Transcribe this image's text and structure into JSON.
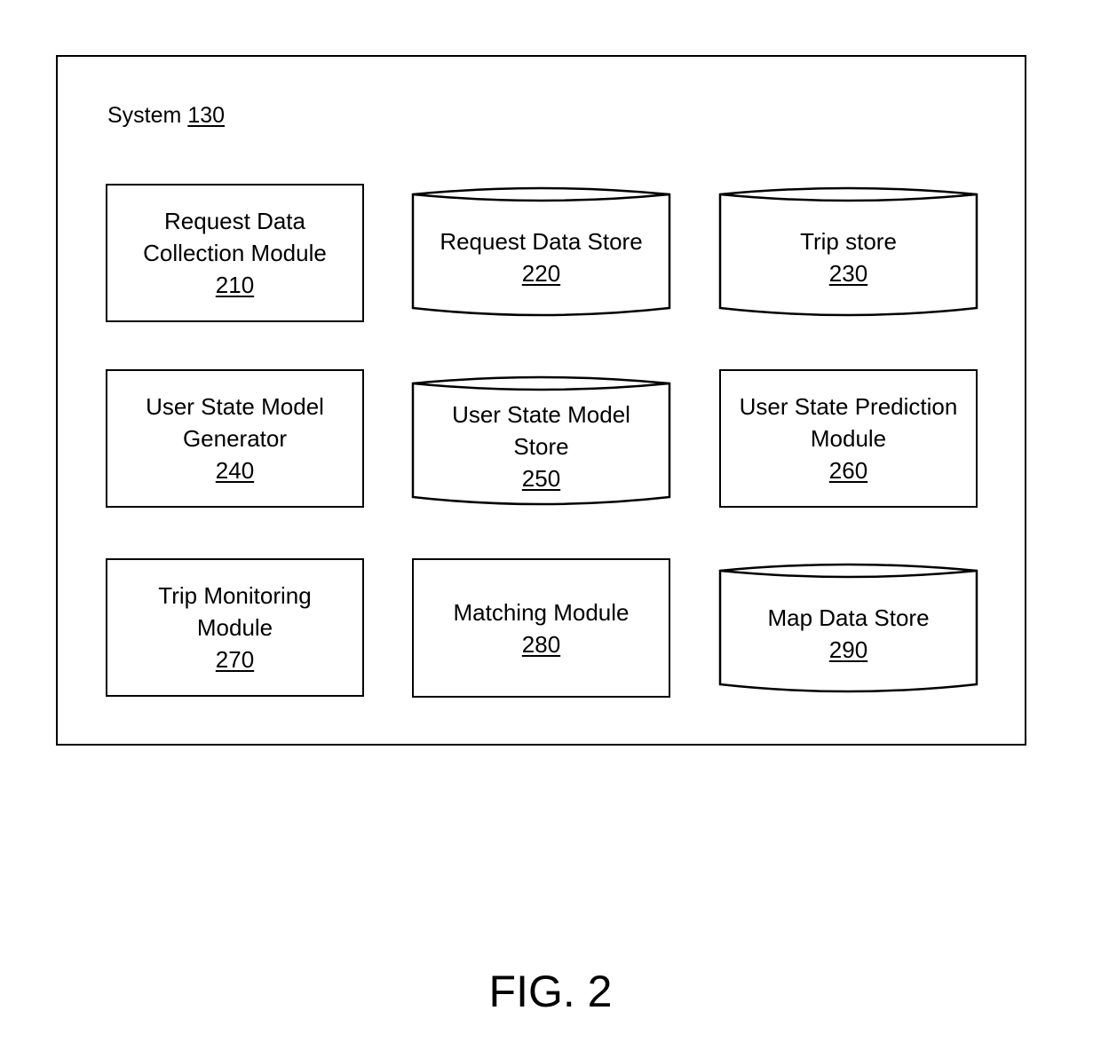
{
  "system": {
    "label": "System",
    "ref": "130"
  },
  "nodes": [
    {
      "id": "210",
      "shape": "rect",
      "lines": [
        "Request Data",
        "Collection Module"
      ],
      "ref": "210"
    },
    {
      "id": "220",
      "shape": "cylinder",
      "lines": [
        "Request Data Store"
      ],
      "ref": "220"
    },
    {
      "id": "230",
      "shape": "cylinder",
      "lines": [
        "Trip store"
      ],
      "ref": "230"
    },
    {
      "id": "240",
      "shape": "rect",
      "lines": [
        "User State Model",
        "Generator"
      ],
      "ref": "240"
    },
    {
      "id": "250",
      "shape": "cylinder",
      "lines": [
        "User State Model",
        "Store"
      ],
      "ref": "250"
    },
    {
      "id": "260",
      "shape": "rect",
      "lines": [
        "User State Prediction",
        "Module"
      ],
      "ref": "260"
    },
    {
      "id": "270",
      "shape": "rect",
      "lines": [
        "Trip Monitoring",
        "Module"
      ],
      "ref": "270"
    },
    {
      "id": "280",
      "shape": "rect",
      "lines": [
        "Matching Module"
      ],
      "ref": "280"
    },
    {
      "id": "290",
      "shape": "cylinder",
      "lines": [
        "Map Data Store"
      ],
      "ref": "290"
    }
  ],
  "figure": {
    "caption": "FIG. 2"
  }
}
